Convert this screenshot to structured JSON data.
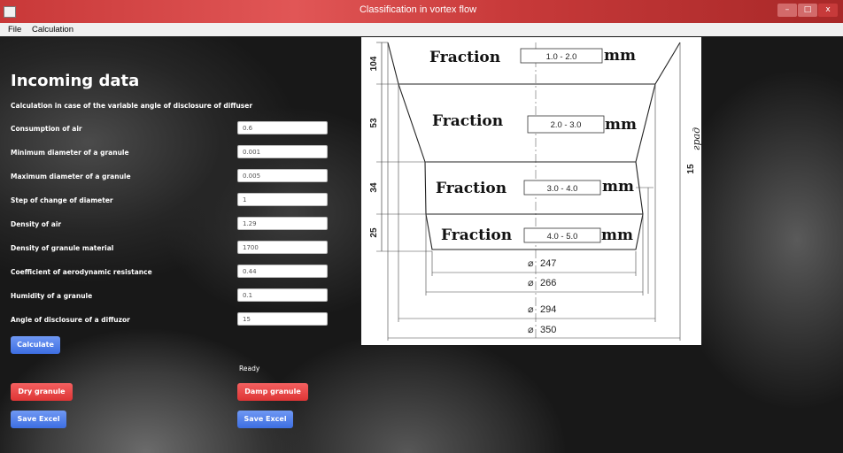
{
  "window": {
    "title": "Classification in vortex flow",
    "controls": {
      "minimize": "–",
      "maximize": "□",
      "close": "x"
    }
  },
  "menu": {
    "items": [
      "File",
      "Calculation"
    ]
  },
  "form": {
    "heading": "Incoming data",
    "subheading": "Calculation in case of the variable angle of disclosure of diffuser",
    "params": [
      {
        "label": "Consumption of air",
        "value": "0.6"
      },
      {
        "label": "Minimum diameter of a granule",
        "value": "0.001"
      },
      {
        "label": "Maximum diameter of a granule",
        "value": "0.005"
      },
      {
        "label": "Step of change of diameter",
        "value": "1"
      },
      {
        "label": "Density of air",
        "value": "1.29"
      },
      {
        "label": "Density of granule material",
        "value": "1700"
      },
      {
        "label": "Coefficient of aerodynamic resistance",
        "value": "0.44"
      },
      {
        "label": "Humidity of a granule",
        "value": "0.1"
      },
      {
        "label": "Angle of disclosure of a diffuzor",
        "value": "15"
      }
    ],
    "calculate_label": "Calculate",
    "status": "Ready"
  },
  "actions": {
    "dry_label": "Dry granule",
    "damp_label": "Damp granule",
    "save_excel_label": "Save Excel"
  },
  "diagram": {
    "fraction_word": "Fraction",
    "unit": "mm",
    "fractions": [
      "1.0 - 2.0",
      "2.0 - 3.0",
      "3.0 - 4.0",
      "4.0 - 5.0"
    ],
    "heights": [
      "104",
      "53",
      "34",
      "25"
    ],
    "diameter_symbol": "⌀",
    "diameters": [
      "247",
      "266",
      "294",
      "350"
    ],
    "angle_label": "15",
    "angle_unit": "град"
  },
  "colors": {
    "titlebar": "#d94a4a",
    "button_blue": "#4a78e6",
    "button_red": "#e84545"
  }
}
